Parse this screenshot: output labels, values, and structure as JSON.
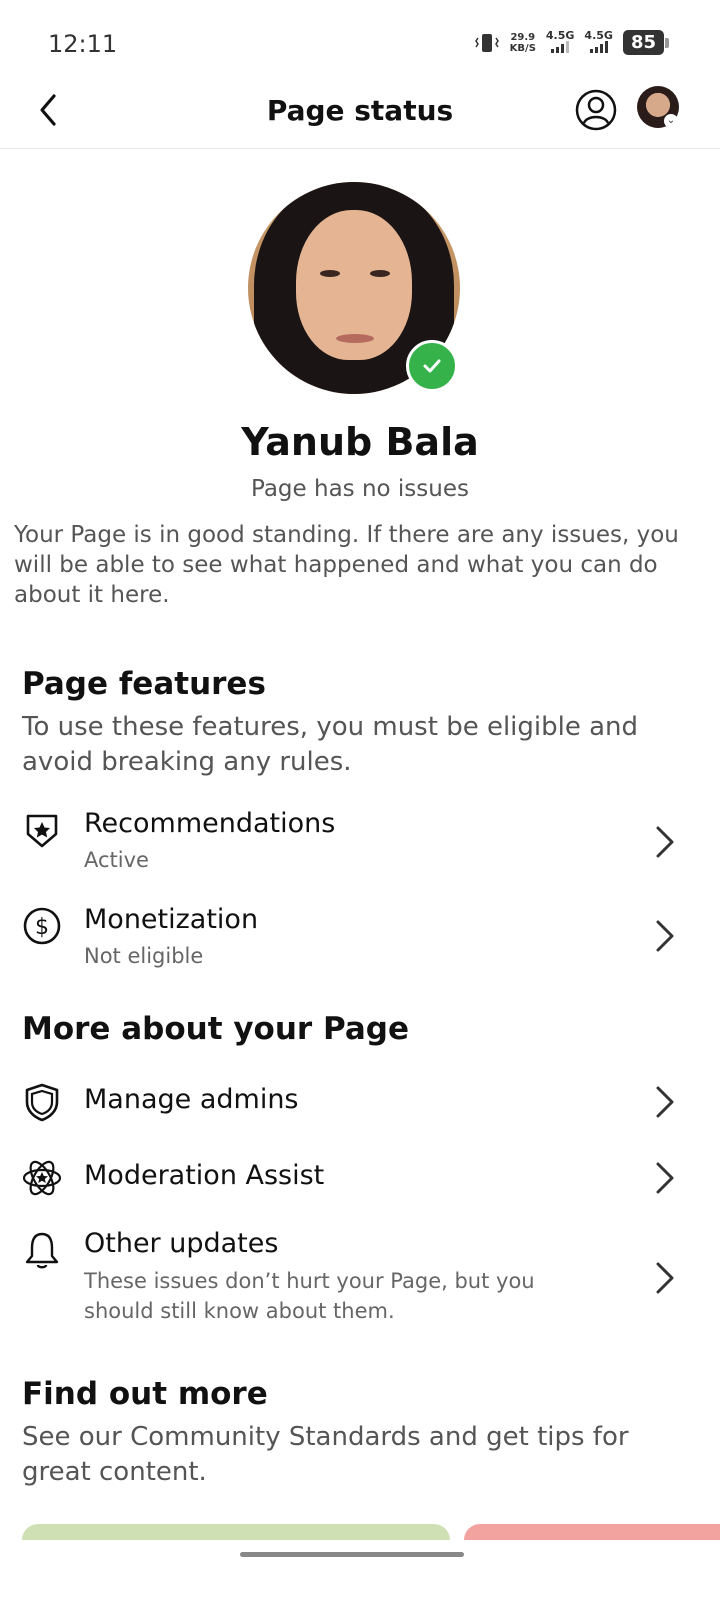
{
  "status_bar": {
    "time": "12:11",
    "speed": "29.9",
    "speed_unit": "KB/S",
    "net1": "4.5G",
    "net2": "4.5G",
    "battery": "85"
  },
  "app_bar": {
    "title": "Page status",
    "back_icon": "chevron-left-icon",
    "profile_icon": "user-circle-icon"
  },
  "profile": {
    "name": "Yanub Bala",
    "status": "Page has no issues",
    "description": "Your Page is in good standing. If there are any issues, you will be able to see what happened and what you can do about it here.",
    "badge_color": "#36b24a"
  },
  "page_features": {
    "title": "Page features",
    "subtitle": "To use these features, you must be eligible and avoid breaking any rules.",
    "items": [
      {
        "label": "Recommendations",
        "sub": "Active",
        "icon": "shield-star-icon"
      },
      {
        "label": "Monetization",
        "sub": "Not eligible",
        "icon": "dollar-circle-icon"
      }
    ]
  },
  "more": {
    "title": "More about your Page",
    "items": [
      {
        "label": "Manage admins",
        "icon": "shield-icon"
      },
      {
        "label": "Moderation Assist",
        "icon": "atom-star-icon"
      },
      {
        "label": "Other updates",
        "sub": "These issues don’t hurt your Page, but you should still know about them.",
        "icon": "bell-icon"
      }
    ]
  },
  "find_out": {
    "title": "Find out more",
    "subtitle": "See our Community Standards and get tips for great content."
  }
}
